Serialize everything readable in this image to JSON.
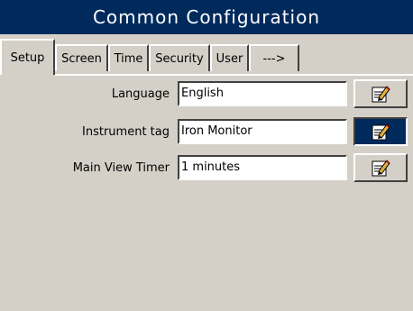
{
  "window": {
    "title": "Common Configuration"
  },
  "tabs": [
    {
      "label": "Setup",
      "active": true
    },
    {
      "label": "Screen",
      "active": false
    },
    {
      "label": "Time",
      "active": false
    },
    {
      "label": "Security",
      "active": false
    },
    {
      "label": "User",
      "active": false
    },
    {
      "label": "--->",
      "active": false
    }
  ],
  "settings": [
    {
      "label": "Language",
      "value": "English",
      "button_icon": "edit-note-icon",
      "selected": false
    },
    {
      "label": "Instrument tag",
      "value": "Iron Monitor",
      "button_icon": "edit-note-icon",
      "selected": true
    },
    {
      "label": "Main View Timer",
      "value": "1 minutes",
      "button_icon": "edit-note-icon",
      "selected": false
    }
  ],
  "colors": {
    "titlebar_bg": "#002a5c",
    "panel_bg": "#d4d0c8",
    "selected_button_bg": "#002a5c"
  }
}
